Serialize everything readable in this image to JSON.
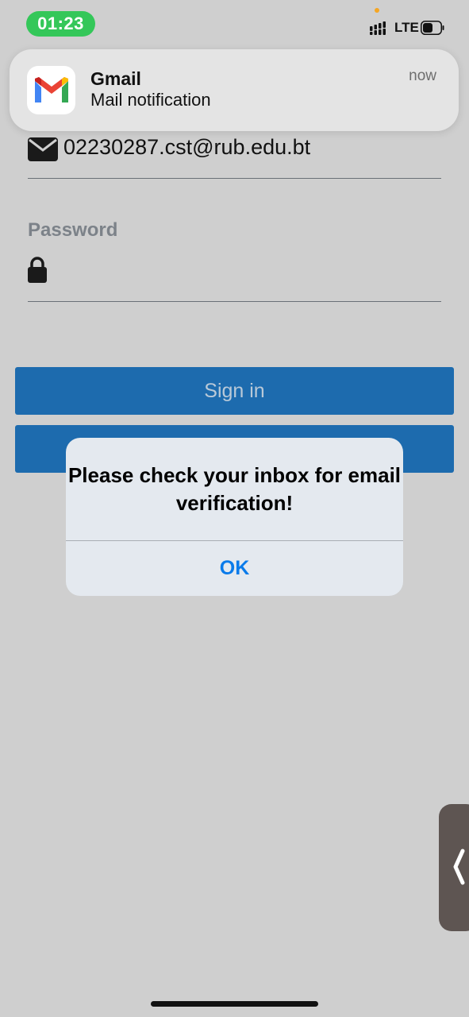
{
  "status_bar": {
    "time": "01:23",
    "network": "LTE",
    "time_pill_color": "#34c759"
  },
  "notification": {
    "app_name": "Gmail",
    "message": "Mail notification",
    "time": "now",
    "icon": "gmail-icon"
  },
  "form": {
    "email": "02230287.cst@rub.edu.bt",
    "email_icon": "mail-icon",
    "password_label": "Password",
    "password_icon": "lock-icon",
    "password_value": "",
    "sign_in_label": "Sign in",
    "second_button_label": "",
    "button_color": "#1d6bae"
  },
  "dialog": {
    "message": "Please check your inbox for email verification!",
    "ok_label": "OK",
    "ok_color": "#0a7bea"
  },
  "side_handle": {
    "icon": "chevron-left-icon"
  }
}
